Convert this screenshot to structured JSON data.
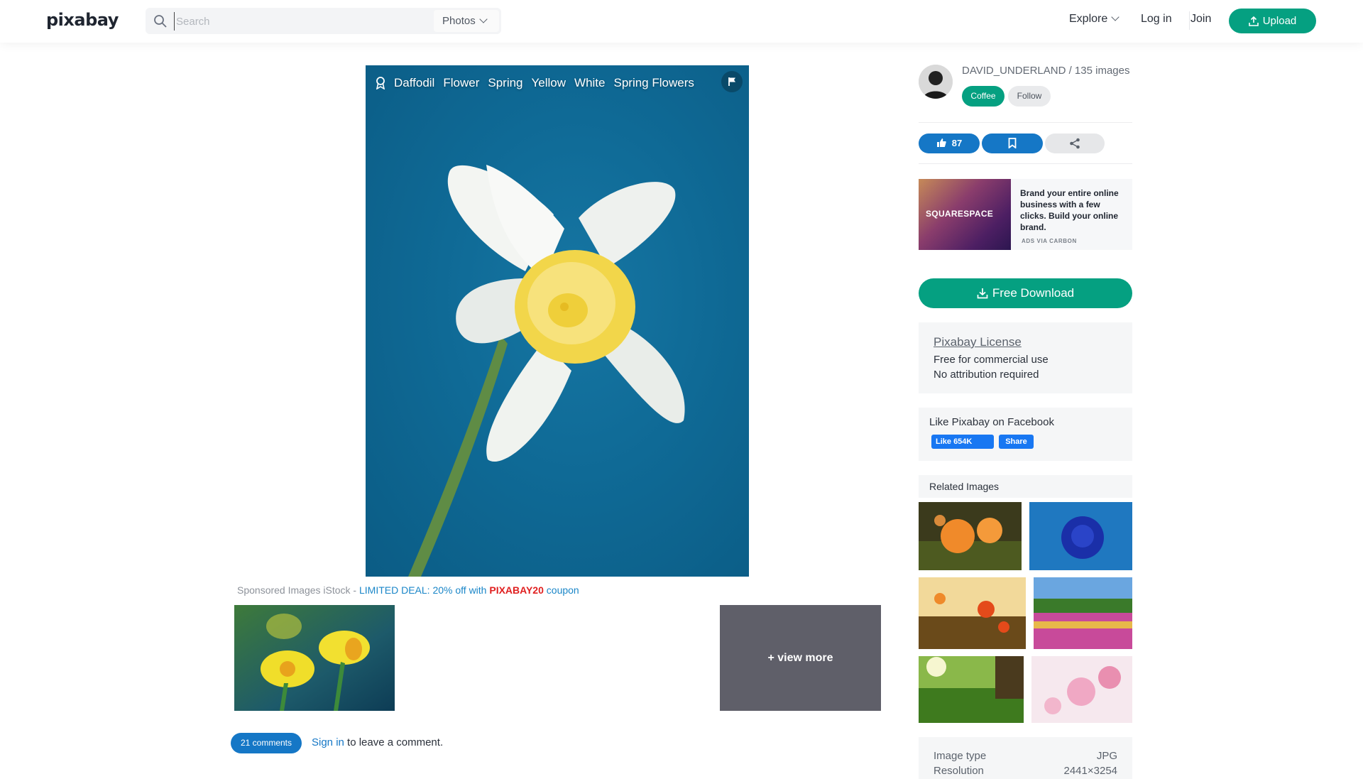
{
  "header": {
    "logo": "pixabay",
    "search_placeholder": "Search",
    "search_type": "Photos",
    "explore": "Explore",
    "login": "Log in",
    "join": "Join",
    "upload": "Upload"
  },
  "image": {
    "tags": [
      "Daffodil",
      "Flower",
      "Spring",
      "Yellow",
      "White",
      "Spring Flowers"
    ]
  },
  "sponsored": {
    "prefix": "Sponsored Images iStock - ",
    "deal": "LIMITED DEAL: 20% off with ",
    "code": "PIXABAY20",
    "suffix": " coupon",
    "view_more": "+ view more"
  },
  "comments": {
    "count_label": "21 comments",
    "sign_in": "Sign in",
    "rest": " to leave a comment."
  },
  "sidebar": {
    "user": "DAVID_UNDERLAND / 135 images",
    "coffee": "Coffee",
    "follow": "Follow",
    "likes": "87",
    "ad": {
      "brand": "SQUARESPACE",
      "text": "Brand your entire online business with a few clicks. Build your online brand.",
      "via": "ADS VIA CARBON"
    },
    "download": "Free Download",
    "license": {
      "title": "Pixabay License",
      "line1": "Free for commercial use",
      "line2": "No attribution required"
    },
    "facebook": {
      "title": "Like Pixabay on Facebook",
      "like": "Like 654K",
      "share": "Share"
    },
    "related_title": "Related Images",
    "meta": [
      {
        "key": "Image type",
        "value": "JPG"
      },
      {
        "key": "Resolution",
        "value": "2441×3254"
      }
    ]
  },
  "colors": {
    "accent_green": "#05a081",
    "accent_blue": "#1577c6",
    "deal_red": "#e02020"
  }
}
